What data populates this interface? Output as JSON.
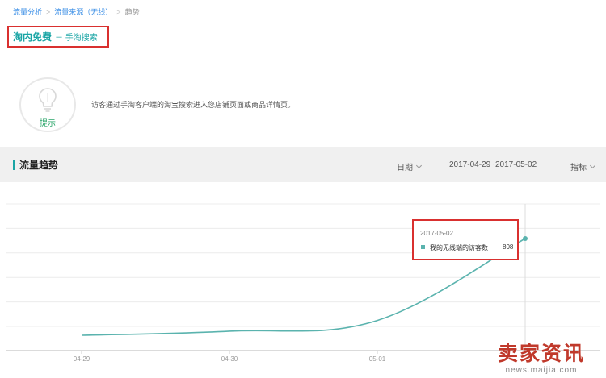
{
  "breadcrumb": {
    "items": [
      {
        "label": "流量分析"
      },
      {
        "label": "流量来源（无线）"
      },
      {
        "label": "趋势"
      }
    ]
  },
  "page_title": {
    "main": "淘内免费",
    "sub": "－ 手淘搜索"
  },
  "tip": {
    "label": "提示",
    "text": "访客通过手淘客户端的淘宝搜索进入您店铺页面或商品详情页。"
  },
  "trend": {
    "title": "流量趋势",
    "date_selector": "日期",
    "date_range": "2017-04-29~2017-05-02",
    "metric_selector": "指标"
  },
  "chart_data": {
    "type": "line",
    "categories": [
      "04-29",
      "04-30",
      "05-01",
      "05-02"
    ],
    "series": [
      {
        "name": "我的无线端的访客数",
        "values": [
          0,
          34,
          124,
          808
        ],
        "color": "#5ab3ae"
      }
    ],
    "grid": true,
    "legend": "tooltip",
    "hover_index": 3
  },
  "tooltip": {
    "date": "2017-05-02",
    "series_label": "我的无线端的访客数",
    "value": "808"
  },
  "watermark": {
    "main": "卖家资讯",
    "sub": "news.maijia.com"
  },
  "colors": {
    "accent": "#1aa5a5",
    "line": "#5ab3ae",
    "highlight_border": "#d9302f",
    "link": "#3a8ee6"
  }
}
